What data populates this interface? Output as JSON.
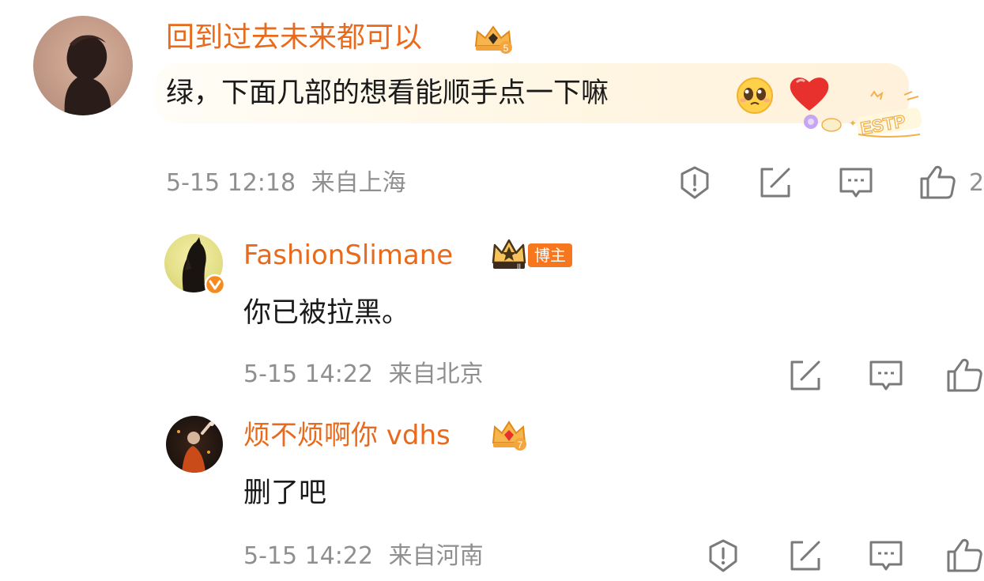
{
  "comments": [
    {
      "username": "回到过去未来都可以",
      "level_badge": "crown-gem-level-5",
      "text": "绿，下面几部的想看能顺手点一下嘛",
      "emojis": [
        "pleading-face-emoji",
        "red-heart-emoji"
      ],
      "bubble_tag": "ESTP",
      "time": "5-15 12:18",
      "location": "来自上海",
      "like_count": "2",
      "actions": [
        "report-icon",
        "repost-icon",
        "reply-icon",
        "like-icon"
      ]
    }
  ],
  "replies": [
    {
      "username": "FashionSlimane",
      "level_badge": "crown-level-2",
      "role_badge": "博主",
      "verified": true,
      "text": "你已被拉黑。",
      "time": "5-15 14:22",
      "location": "来自北京",
      "actions": [
        "repost-icon",
        "reply-icon",
        "like-icon"
      ]
    },
    {
      "username": "烦不烦啊你 vdhs",
      "level_badge": "crown-gem-level-7",
      "text": "删了吧",
      "time": "5-15 14:22",
      "location": "来自河南",
      "actions": [
        "report-icon",
        "repost-icon",
        "reply-icon",
        "like-icon"
      ]
    }
  ],
  "colors": {
    "username": "#E86A1C",
    "meta_text": "#8F8F8F",
    "body_text": "#1A1A1A",
    "host_badge": "#F7771E",
    "icon_stroke": "#7A7A7A"
  }
}
